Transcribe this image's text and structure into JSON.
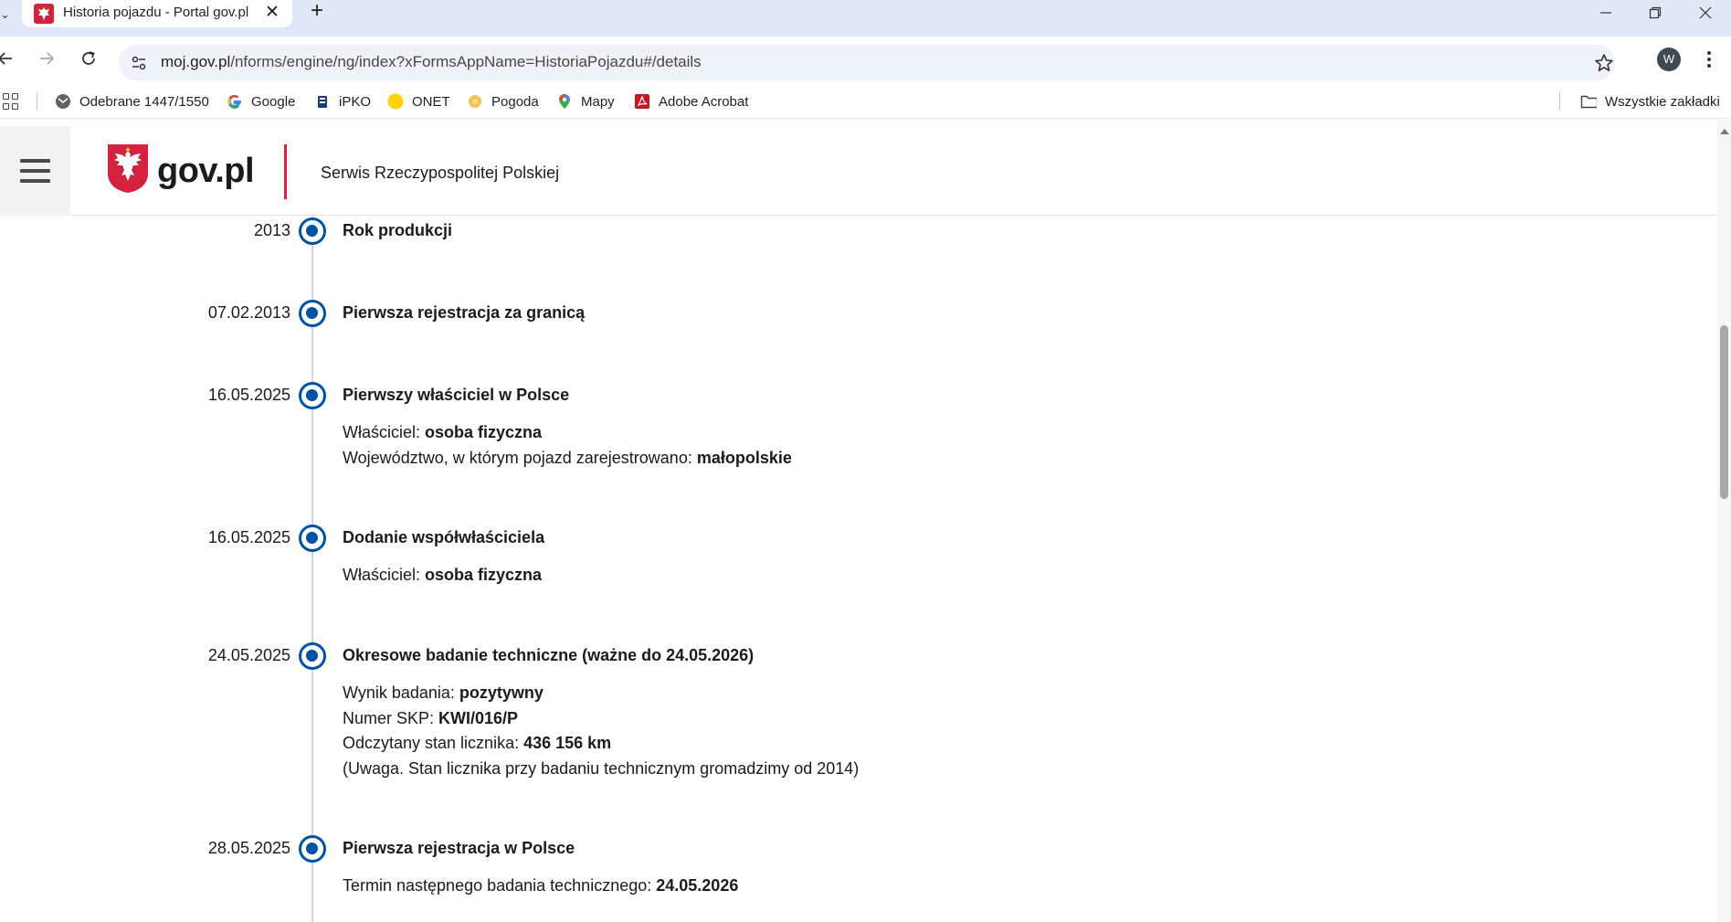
{
  "browser": {
    "tab_title": "Historia pojazdu - Portal gov.pl",
    "url_host": "moj.gov.pl",
    "url_path": "/nforms/engine/ng/index?xFormsAppName=HistoriaPojazdu#/details",
    "profile_initial": "W",
    "bookmarks": [
      {
        "label": "Odebrane 1447/1550",
        "icon": "gmail-icon"
      },
      {
        "label": "Google",
        "icon": "google-icon"
      },
      {
        "label": "iPKO",
        "icon": "ipko-icon"
      },
      {
        "label": "ONET",
        "icon": "onet-icon"
      },
      {
        "label": "Pogoda",
        "icon": "weather-icon"
      },
      {
        "label": "Mapy",
        "icon": "maps-pin-icon"
      },
      {
        "label": "Adobe Acrobat",
        "icon": "acrobat-icon"
      }
    ],
    "all_bookmarks": "Wszystkie zakładki"
  },
  "header": {
    "logo_text": "gov.pl",
    "subtitle": "Serwis Rzeczypospolitej Polskiej"
  },
  "colors": {
    "timeline_accent": "#0052a5",
    "header_divider": "#d5233f",
    "emblem_red": "#d4213d"
  },
  "timeline": [
    {
      "date": "2013",
      "title": "Rok produkcji",
      "lines": []
    },
    {
      "date": "07.02.2013",
      "title": "Pierwsza rejestracja za granicą",
      "lines": []
    },
    {
      "date": "16.05.2025",
      "title": "Pierwszy właściciel w Polsce",
      "lines": [
        {
          "label": "Właściciel: ",
          "value": "osoba fizyczna"
        },
        {
          "label": "Województwo, w którym pojazd zarejestrowano: ",
          "value": "małopolskie"
        }
      ]
    },
    {
      "date": "16.05.2025",
      "title": "Dodanie współwłaściciela",
      "lines": [
        {
          "label": "Właściciel: ",
          "value": "osoba fizyczna"
        }
      ]
    },
    {
      "date": "24.05.2025",
      "title": "Okresowe badanie techniczne (ważne do 24.05.2026)",
      "lines": [
        {
          "label": "Wynik badania: ",
          "value": "pozytywny"
        },
        {
          "label": "Numer SKP: ",
          "value": "KWI/016/P"
        },
        {
          "label": "Odczytany stan licznika: ",
          "value": "436 156 km"
        },
        {
          "label": "(Uwaga. Stan licznika przy badaniu technicznym gromadzimy od 2014)",
          "value": ""
        }
      ]
    },
    {
      "date": "28.05.2025",
      "title": "Pierwsza rejestracja w Polsce",
      "lines": [
        {
          "label": "Termin następnego badania technicznego: ",
          "value": "24.05.2026"
        }
      ]
    }
  ]
}
